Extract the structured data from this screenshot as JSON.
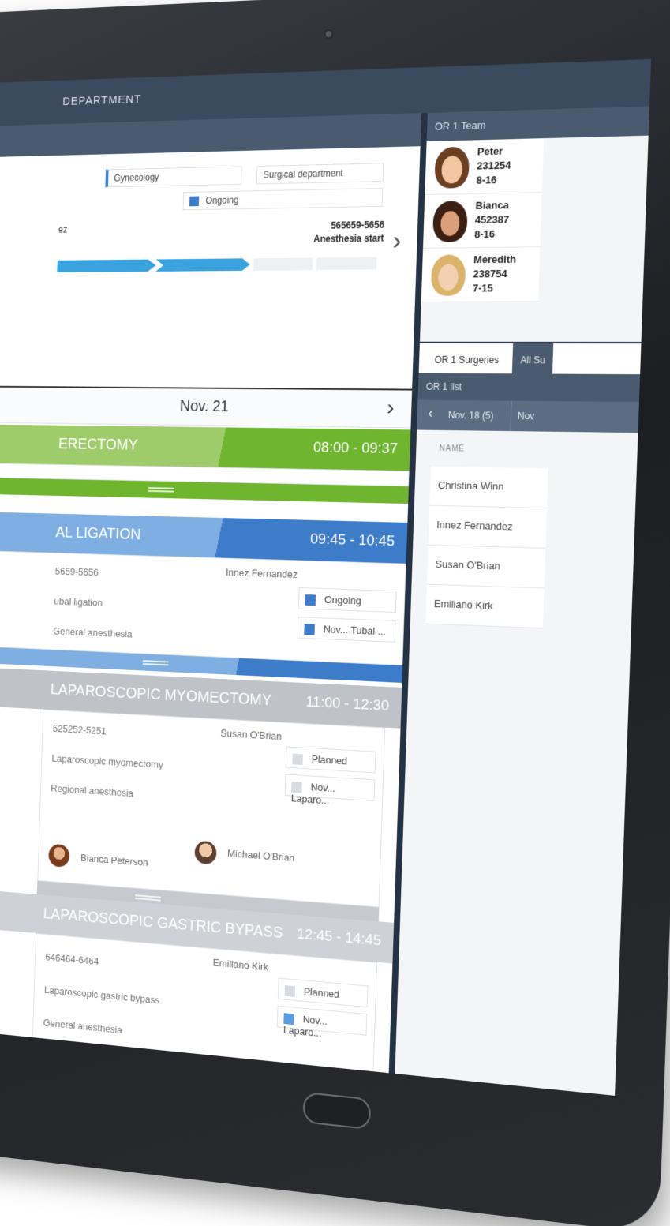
{
  "header": {
    "title": "DEPARTMENT"
  },
  "procedure_info": {
    "specialty": "Gynecology",
    "department": "Surgical department",
    "status": "Ongoing",
    "patient_suffix": "ez",
    "patient_id": "565659-5656",
    "phase": "Anesthesia start"
  },
  "schedule": {
    "date": "Nov. 21",
    "surgeries": [
      {
        "title": "ERECTOMY",
        "time": "08:00 - 09:37",
        "color": "#6fb52e",
        "color_light": "#9fcc6a"
      },
      {
        "title": "AL LIGATION",
        "time": "09:45 - 10:45",
        "color": "#3d7cc9",
        "color_light": "#7eaee2",
        "patient_id": "5659-5656",
        "procedure": "ubal ligation",
        "anesthesia": "General anesthesia",
        "patient": "Innez Fernandez",
        "status": "Ongoing",
        "note": "Nov... Tubal ..."
      },
      {
        "title": "LAPAROSCOPIC MYOMECTOMY",
        "time": "11:00 - 12:30",
        "color": "#b9bdc2",
        "patient_id": "525252-5251",
        "procedure": "Laparoscopic myomectomy",
        "anesthesia": "Regional anesthesia",
        "patient": "Susan O'Brian",
        "status": "Planned",
        "note": "Nov... Laparo...",
        "staff": [
          "Bianca Peterson",
          "Michael O'Brian"
        ]
      },
      {
        "title": "LAPAROSCOPIC GASTRIC BYPASS",
        "time": "12:45 - 14:45",
        "color": "#cdd1d6",
        "patient_id": "646464-6464",
        "procedure": "Laparoscopic gastric bypass",
        "anesthesia": "General anesthesia",
        "patient": "Emiliano Kirk",
        "status": "Planned",
        "note": "Nov... Laparo..."
      }
    ]
  },
  "team": {
    "title": "OR 1 Team",
    "members": [
      {
        "name": "Peter",
        "id": "231254",
        "shift": "8-16"
      },
      {
        "name": "Bianca",
        "id": "452387",
        "shift": "8-16"
      },
      {
        "name": "Meredith",
        "id": "238754",
        "shift": "7-15"
      }
    ]
  },
  "surgeries_panel": {
    "tabs": [
      "OR 1 Surgeries",
      "All Su"
    ],
    "list_title": "OR 1 list",
    "date_nav": [
      "Nov. 18 (5)",
      "Nov"
    ],
    "column": "NAME",
    "patients": [
      "Christina Winn",
      "Innez Fernandez",
      "Susan O'Brian",
      "Emiliano Kirk"
    ]
  }
}
